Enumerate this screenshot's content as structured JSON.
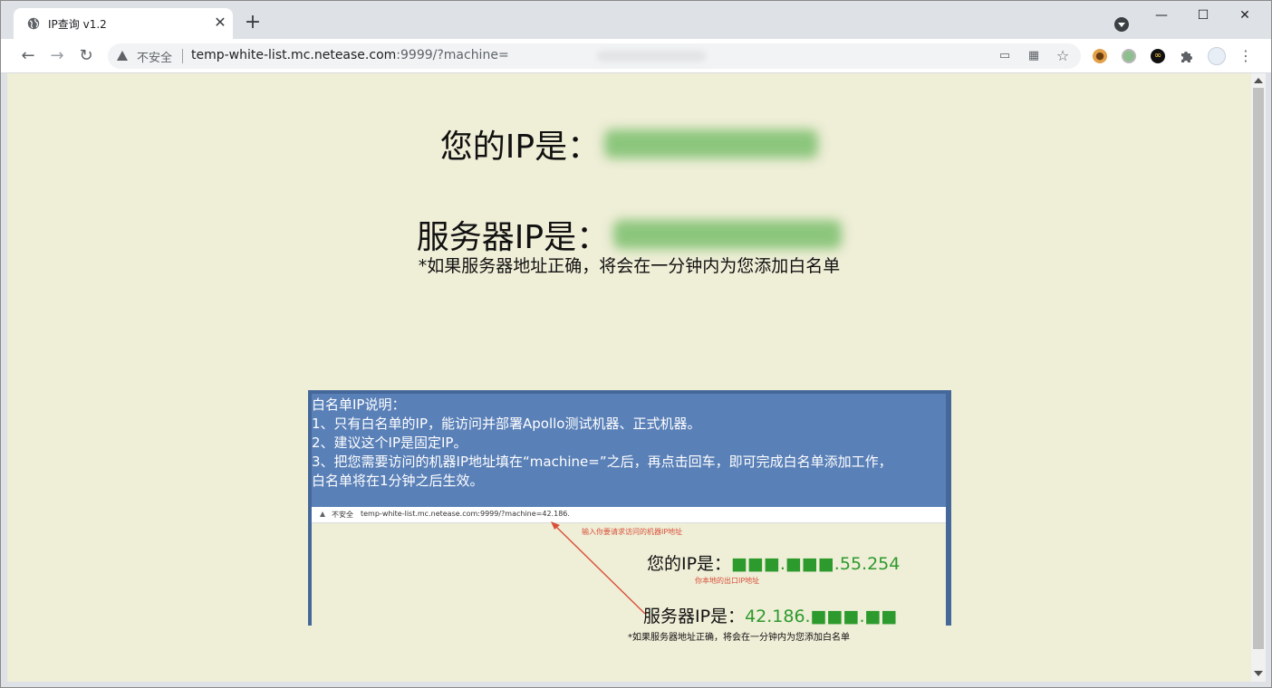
{
  "browser": {
    "tab_title": "IP查询 v1.2",
    "tab_close": "✕",
    "new_tab": "+",
    "minimize": "—",
    "maximize": "☐",
    "close": "✕",
    "back": "←",
    "forward": "→",
    "reload": "↻",
    "insecure_label": "不安全",
    "url_host": "temp-white-list.mc.netease.com",
    "url_rest": ":9999/?machine=",
    "menu": "⋮"
  },
  "page": {
    "your_ip_label": "您的IP是：",
    "server_ip_label": "服务器IP是：",
    "note": "*如果服务器地址正确，将会在一分钟内为您添加白名单"
  },
  "panel": {
    "lines": [
      "白名单IP说明：",
      "1、只有白名单的IP，能访问并部署Apollo测试机器、正式机器。",
      "2、建议这个IP是固定IP。",
      "3、把您需要访问的机器IP地址填在“machine=”之后，再点击回车，即可完成白名单添加工作，",
      "白名单将在1分钟之后生效。"
    ]
  },
  "screenshot_example": {
    "insecure_label": "不安全",
    "url": "temp-white-list.mc.netease.com:9999/?machine=42.186.",
    "hint_input": "输入你要请求访问的机器IP地址",
    "your_ip_label": "您的IP是：",
    "your_ip_value": "■■■.■■■.55.254",
    "your_ip_hint": "你本地的出口IP地址",
    "server_ip_label": "服务器IP是：",
    "server_ip_value": "42.186.■■■.■■",
    "note": "*如果服务器地址正确，将会在一分钟内为您添加白名单"
  },
  "colors": {
    "page_bg": "#efeed7",
    "panel_bg": "#5a80b8",
    "panel_border": "#45689a",
    "ip_value_green": "#2d9a2d",
    "hint_red": "#d9503a"
  }
}
